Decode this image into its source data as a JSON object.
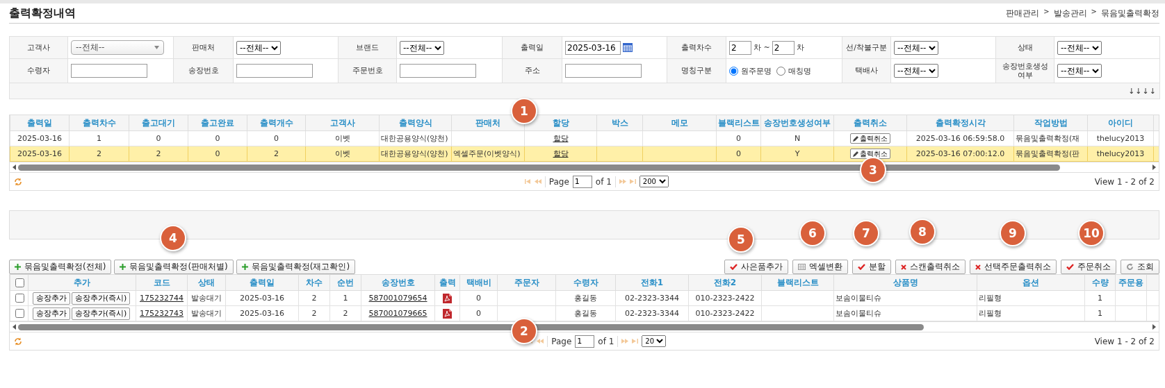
{
  "title": "출력확정내역",
  "breadcrumb": [
    {
      "kind": "item",
      "text": "판매관리"
    },
    {
      "kind": "separator",
      "text": ">"
    },
    {
      "kind": "item",
      "text": "발송관리"
    },
    {
      "kind": "separator",
      "text": ">"
    },
    {
      "kind": "item",
      "text": "묶음및출력확정"
    }
  ],
  "filters": {
    "rows": [
      [
        {
          "label": "고객사",
          "kind": "combo",
          "value": "--전체--"
        },
        {
          "label": "판매처",
          "kind": "select",
          "value": "--전체--"
        },
        {
          "label": "브랜드",
          "kind": "select",
          "value": "--전체--"
        },
        {
          "label": "출력일",
          "kind": "date",
          "value": "2025-03-16"
        },
        {
          "label": "출력차수",
          "kind": "range",
          "from": "2",
          "sep": "차 ~",
          "to": "2",
          "unit": "차"
        },
        {
          "label": "선/착불구분",
          "kind": "select",
          "value": "--전체--"
        },
        {
          "label": "상태",
          "kind": "select",
          "value": "--전체-- "
        }
      ],
      [
        {
          "label": "수령자",
          "kind": "input"
        },
        {
          "label": "송장번호",
          "kind": "input"
        },
        {
          "label": "주문번호",
          "kind": "input"
        },
        {
          "label": "주소",
          "kind": "input"
        },
        {
          "label": "명칭구분",
          "kind": "radio",
          "options": [
            {
              "label": "원주문명",
              "selected": true
            },
            {
              "label": "매칭명",
              "selected": false
            }
          ]
        },
        {
          "label": "택배사",
          "kind": "select",
          "value": "--전체--"
        },
        {
          "label": "송장번호생성여부",
          "kind": "select",
          "value": "--전체-- "
        }
      ]
    ],
    "arrows": "↓↓↓↓"
  },
  "upper_grid": {
    "columns": [
      {
        "label": "출력일",
        "kind": "text"
      },
      {
        "label": "출력차수",
        "kind": "text"
      },
      {
        "label": "출고대기",
        "kind": "text"
      },
      {
        "label": "출고완료",
        "kind": "text"
      },
      {
        "label": "출력개수",
        "kind": "text"
      },
      {
        "label": "고객사",
        "kind": "text"
      },
      {
        "label": "출력양식",
        "kind": "left"
      },
      {
        "label": "판매처",
        "kind": "left"
      },
      {
        "label": "할당",
        "kind": "link"
      },
      {
        "label": "박스",
        "kind": "text"
      },
      {
        "label": "메모",
        "kind": "text"
      },
      {
        "label": "블랙리스트",
        "kind": "text"
      },
      {
        "label": "송장번호생성여부",
        "kind": "text"
      },
      {
        "label": "출력취소",
        "kind": "button"
      },
      {
        "label": "출력확정시각",
        "kind": "text"
      },
      {
        "label": "작업방법",
        "kind": "left"
      },
      {
        "label": "아이디",
        "kind": "text"
      }
    ],
    "rows": [
      {
        "selected": false,
        "cells": [
          "2025-03-16",
          "1",
          "0",
          "0",
          "0",
          "이벳",
          "대한공용양식(양천)",
          null,
          "할당",
          null,
          null,
          "0",
          "N",
          "출력취소",
          "2025-03-16 06:59:58.0",
          "묶음및출력확정(재",
          "thelucy2013"
        ]
      },
      {
        "selected": true,
        "cells": [
          "2025-03-16",
          "2",
          "2",
          "0",
          "2",
          "이벳",
          "대한공용양식(양천)",
          "엑셀주문(이벳양식)",
          "할당",
          null,
          null,
          "0",
          "Y",
          "출력취소",
          "2025-03-16 07:00:12.0",
          "묶음및출력확정(판",
          "thelucy2013"
        ]
      }
    ],
    "pager": {
      "page_label": "Page",
      "page": "1",
      "of": "of 1",
      "page_size": "200",
      "view": "View 1 - 2 of 2"
    }
  },
  "left_actions": [
    {
      "kind": "plus",
      "label": "묶음및출력확정(전체)"
    },
    {
      "kind": "plus",
      "label": "묶음및출력확정(판매처별)"
    },
    {
      "kind": "plus",
      "label": "묶음및출력확정(재고확인)"
    }
  ],
  "right_actions": [
    {
      "kind": "check",
      "label": "사은품추가"
    },
    {
      "kind": "grid",
      "label": "엑셀변환"
    },
    {
      "kind": "check",
      "label": "분할"
    },
    {
      "kind": "x",
      "label": "스캔출력취소"
    },
    {
      "kind": "x",
      "label": "선택주문출력취소"
    },
    {
      "kind": "check",
      "label": "주문취소"
    },
    {
      "kind": "refresh",
      "label": "조회"
    }
  ],
  "lower_grid": {
    "header_checked": false,
    "columns": [
      {
        "kind": "check"
      },
      {
        "label": "추가",
        "kind": "buttons"
      },
      {
        "label": "코드",
        "kind": "link"
      },
      {
        "label": "상태",
        "kind": "text"
      },
      {
        "label": "출력일",
        "kind": "text"
      },
      {
        "label": "차수",
        "kind": "text"
      },
      {
        "label": "순번",
        "kind": "text"
      },
      {
        "label": "송장번호",
        "kind": "link"
      },
      {
        "label": "출력",
        "kind": "pdf"
      },
      {
        "label": "택배비",
        "kind": "text"
      },
      {
        "label": "주문자",
        "kind": "text"
      },
      {
        "label": "수령자",
        "kind": "text"
      },
      {
        "label": "전화1",
        "kind": "text"
      },
      {
        "label": "전화2",
        "kind": "text"
      },
      {
        "label": "블랙리스트",
        "kind": "text"
      },
      {
        "label": "상품명",
        "kind": "left"
      },
      {
        "label": "옵션",
        "kind": "left"
      },
      {
        "label": "수량",
        "kind": "text"
      },
      {
        "label": "주문용",
        "kind": "text"
      }
    ],
    "rows": [
      {
        "checked": false,
        "cells": [
          null,
          [
            "송장추가",
            "송장추가(즉시)"
          ],
          "175232744",
          "발송대기",
          "2025-03-16",
          "2",
          "1",
          "587001079654",
          null,
          "0",
          null,
          "홍길동",
          "02-2323-3344",
          "010-2323-2422",
          null,
          "보솜이물티슈",
          "리필형",
          "1",
          null
        ]
      },
      {
        "checked": false,
        "cells": [
          null,
          [
            "송장추가",
            "송장추가(즉시)"
          ],
          "175232743",
          "발송대기",
          "2025-03-16",
          "2",
          "2",
          "587001079665",
          null,
          "0",
          null,
          "홍길동",
          "02-2323-3344",
          "010-2323-2422",
          null,
          "보솜이물티슈",
          "리필형",
          "1",
          null
        ]
      }
    ],
    "pager": {
      "page_label": "Page",
      "page": "1",
      "of": "of 1",
      "page_size": "20",
      "view": "View 1 - 2 of 2"
    }
  },
  "markers": [
    {
      "label": "1"
    },
    {
      "label": "2"
    },
    {
      "label": "3"
    },
    {
      "label": "4"
    },
    {
      "label": "5"
    },
    {
      "label": "6"
    },
    {
      "label": "7"
    },
    {
      "label": "8"
    },
    {
      "label": "9"
    },
    {
      "label": "10"
    }
  ]
}
